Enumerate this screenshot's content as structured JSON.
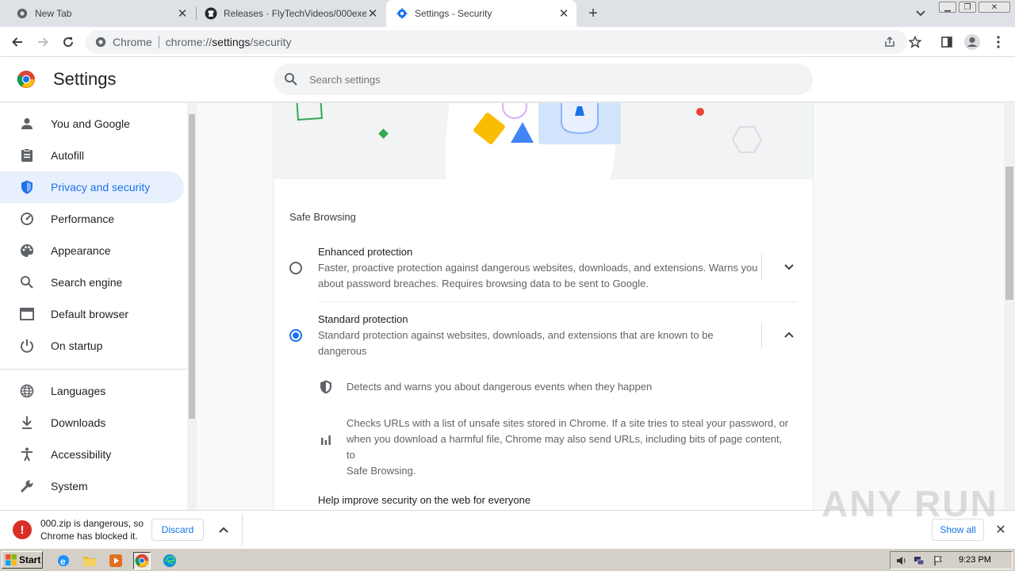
{
  "tabs": [
    {
      "title": "New Tab",
      "icon": "chrome-icon"
    },
    {
      "title": "Releases · FlyTechVideos/000exe",
      "icon": "github-icon"
    },
    {
      "title": "Settings - Security",
      "icon": "settings-gear-icon",
      "active": true
    }
  ],
  "omnibox": {
    "chip": "Chrome",
    "url_prefix": "chrome://",
    "url_host": "settings",
    "url_path": "/security"
  },
  "header": {
    "title": "Settings",
    "search_placeholder": "Search settings"
  },
  "sidebar": {
    "items": [
      {
        "label": "You and Google",
        "icon": "person-icon"
      },
      {
        "label": "Autofill",
        "icon": "clipboard-icon"
      },
      {
        "label": "Privacy and security",
        "icon": "shield-icon",
        "active": true
      },
      {
        "label": "Performance",
        "icon": "speedometer-icon"
      },
      {
        "label": "Appearance",
        "icon": "palette-icon"
      },
      {
        "label": "Search engine",
        "icon": "search-icon"
      },
      {
        "label": "Default browser",
        "icon": "browser-window-icon"
      },
      {
        "label": "On startup",
        "icon": "power-icon"
      },
      {
        "label": "Languages",
        "icon": "globe-icon"
      },
      {
        "label": "Downloads",
        "icon": "download-icon"
      },
      {
        "label": "Accessibility",
        "icon": "accessibility-icon"
      },
      {
        "label": "System",
        "icon": "wrench-icon"
      }
    ]
  },
  "main": {
    "section_title": "Safe Browsing",
    "options": [
      {
        "title": "Enhanced protection",
        "desc_line1": "Faster, proactive protection against dangerous websites, downloads, and extensions. Warns you",
        "desc_line2": "about password breaches. Requires browsing data to be sent to Google.",
        "selected": false
      },
      {
        "title": "Standard protection",
        "desc_line1": "Standard protection against websites, downloads, and extensions that are known to be",
        "desc_line2": "dangerous",
        "selected": true
      }
    ],
    "details": [
      {
        "text": "Detects and warns you about dangerous events when they happen",
        "icon": "shield-check-icon"
      },
      {
        "line1": "Checks URLs with a list of unsafe sites stored in Chrome. If a site tries to steal your password, or",
        "line2": "when you download a harmful file, Chrome may also send URLs, including bits of page content, to",
        "line3": "Safe Browsing.",
        "icon": "bar-chart-icon"
      }
    ],
    "help_title": "Help improve security on the web for everyone"
  },
  "download_bar": {
    "message_line1": "000.zip is dangerous, so",
    "message_line2": "Chrome has blocked it.",
    "discard_label": "Discard",
    "show_all_label": "Show all",
    "watermark": "ANY RUN"
  },
  "taskbar": {
    "start_label": "Start",
    "clock": "9:23 PM"
  },
  "colors": {
    "accent": "#1a73e8",
    "active_nav_bg": "#e8f0fe",
    "danger": "#d93025",
    "taskbar": "#d4d0c8"
  }
}
